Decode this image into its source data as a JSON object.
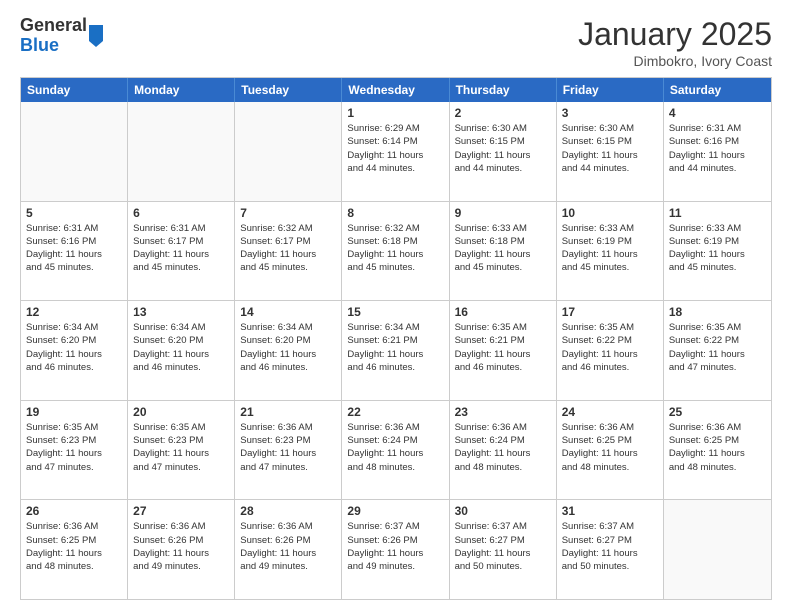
{
  "header": {
    "logo_general": "General",
    "logo_blue": "Blue",
    "month_title": "January 2025",
    "location": "Dimbokro, Ivory Coast"
  },
  "days_of_week": [
    "Sunday",
    "Monday",
    "Tuesday",
    "Wednesday",
    "Thursday",
    "Friday",
    "Saturday"
  ],
  "weeks": [
    [
      {
        "day": "",
        "info": ""
      },
      {
        "day": "",
        "info": ""
      },
      {
        "day": "",
        "info": ""
      },
      {
        "day": "1",
        "info": "Sunrise: 6:29 AM\nSunset: 6:14 PM\nDaylight: 11 hours\nand 44 minutes."
      },
      {
        "day": "2",
        "info": "Sunrise: 6:30 AM\nSunset: 6:15 PM\nDaylight: 11 hours\nand 44 minutes."
      },
      {
        "day": "3",
        "info": "Sunrise: 6:30 AM\nSunset: 6:15 PM\nDaylight: 11 hours\nand 44 minutes."
      },
      {
        "day": "4",
        "info": "Sunrise: 6:31 AM\nSunset: 6:16 PM\nDaylight: 11 hours\nand 44 minutes."
      }
    ],
    [
      {
        "day": "5",
        "info": "Sunrise: 6:31 AM\nSunset: 6:16 PM\nDaylight: 11 hours\nand 45 minutes."
      },
      {
        "day": "6",
        "info": "Sunrise: 6:31 AM\nSunset: 6:17 PM\nDaylight: 11 hours\nand 45 minutes."
      },
      {
        "day": "7",
        "info": "Sunrise: 6:32 AM\nSunset: 6:17 PM\nDaylight: 11 hours\nand 45 minutes."
      },
      {
        "day": "8",
        "info": "Sunrise: 6:32 AM\nSunset: 6:18 PM\nDaylight: 11 hours\nand 45 minutes."
      },
      {
        "day": "9",
        "info": "Sunrise: 6:33 AM\nSunset: 6:18 PM\nDaylight: 11 hours\nand 45 minutes."
      },
      {
        "day": "10",
        "info": "Sunrise: 6:33 AM\nSunset: 6:19 PM\nDaylight: 11 hours\nand 45 minutes."
      },
      {
        "day": "11",
        "info": "Sunrise: 6:33 AM\nSunset: 6:19 PM\nDaylight: 11 hours\nand 45 minutes."
      }
    ],
    [
      {
        "day": "12",
        "info": "Sunrise: 6:34 AM\nSunset: 6:20 PM\nDaylight: 11 hours\nand 46 minutes."
      },
      {
        "day": "13",
        "info": "Sunrise: 6:34 AM\nSunset: 6:20 PM\nDaylight: 11 hours\nand 46 minutes."
      },
      {
        "day": "14",
        "info": "Sunrise: 6:34 AM\nSunset: 6:20 PM\nDaylight: 11 hours\nand 46 minutes."
      },
      {
        "day": "15",
        "info": "Sunrise: 6:34 AM\nSunset: 6:21 PM\nDaylight: 11 hours\nand 46 minutes."
      },
      {
        "day": "16",
        "info": "Sunrise: 6:35 AM\nSunset: 6:21 PM\nDaylight: 11 hours\nand 46 minutes."
      },
      {
        "day": "17",
        "info": "Sunrise: 6:35 AM\nSunset: 6:22 PM\nDaylight: 11 hours\nand 46 minutes."
      },
      {
        "day": "18",
        "info": "Sunrise: 6:35 AM\nSunset: 6:22 PM\nDaylight: 11 hours\nand 47 minutes."
      }
    ],
    [
      {
        "day": "19",
        "info": "Sunrise: 6:35 AM\nSunset: 6:23 PM\nDaylight: 11 hours\nand 47 minutes."
      },
      {
        "day": "20",
        "info": "Sunrise: 6:35 AM\nSunset: 6:23 PM\nDaylight: 11 hours\nand 47 minutes."
      },
      {
        "day": "21",
        "info": "Sunrise: 6:36 AM\nSunset: 6:23 PM\nDaylight: 11 hours\nand 47 minutes."
      },
      {
        "day": "22",
        "info": "Sunrise: 6:36 AM\nSunset: 6:24 PM\nDaylight: 11 hours\nand 48 minutes."
      },
      {
        "day": "23",
        "info": "Sunrise: 6:36 AM\nSunset: 6:24 PM\nDaylight: 11 hours\nand 48 minutes."
      },
      {
        "day": "24",
        "info": "Sunrise: 6:36 AM\nSunset: 6:25 PM\nDaylight: 11 hours\nand 48 minutes."
      },
      {
        "day": "25",
        "info": "Sunrise: 6:36 AM\nSunset: 6:25 PM\nDaylight: 11 hours\nand 48 minutes."
      }
    ],
    [
      {
        "day": "26",
        "info": "Sunrise: 6:36 AM\nSunset: 6:25 PM\nDaylight: 11 hours\nand 48 minutes."
      },
      {
        "day": "27",
        "info": "Sunrise: 6:36 AM\nSunset: 6:26 PM\nDaylight: 11 hours\nand 49 minutes."
      },
      {
        "day": "28",
        "info": "Sunrise: 6:36 AM\nSunset: 6:26 PM\nDaylight: 11 hours\nand 49 minutes."
      },
      {
        "day": "29",
        "info": "Sunrise: 6:37 AM\nSunset: 6:26 PM\nDaylight: 11 hours\nand 49 minutes."
      },
      {
        "day": "30",
        "info": "Sunrise: 6:37 AM\nSunset: 6:27 PM\nDaylight: 11 hours\nand 50 minutes."
      },
      {
        "day": "31",
        "info": "Sunrise: 6:37 AM\nSunset: 6:27 PM\nDaylight: 11 hours\nand 50 minutes."
      },
      {
        "day": "",
        "info": ""
      }
    ]
  ]
}
